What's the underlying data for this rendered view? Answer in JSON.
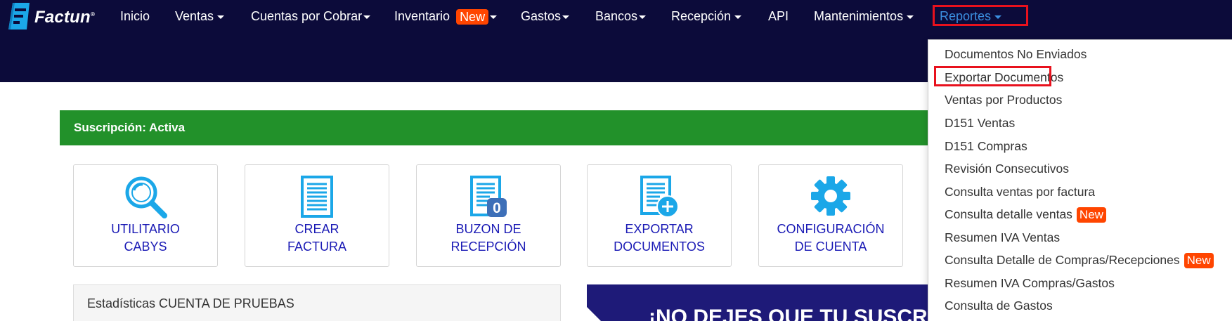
{
  "brand": {
    "name": "Factun",
    "reg": "®"
  },
  "nav": {
    "inicio": "Inicio",
    "ventas": "Ventas",
    "cuentas": "Cuentas por Cobrar",
    "inventario": "Inventario",
    "inventario_badge": "New",
    "gastos": "Gastos",
    "bancos": "Bancos",
    "recepcion": "Recepción",
    "api": "API",
    "mantenimientos": "Mantenimientos",
    "reportes": "Reportes"
  },
  "subscription": {
    "text": "Suscripción: Activa"
  },
  "cards": {
    "cabys": {
      "line1": "UTILITARIO",
      "line2": "CABYS"
    },
    "factura": {
      "line1": "CREAR",
      "line2": "FACTURA"
    },
    "buzon": {
      "line1": "BUZON DE",
      "line2": "RECEPCIÓN",
      "count": "0"
    },
    "exportar": {
      "line1": "EXPORTAR",
      "line2": "DOCUMENTOS"
    },
    "config": {
      "line1": "CONFIGURACIÓN",
      "line2": "DE CUENTA"
    }
  },
  "stats": {
    "title": "Estadísticas CUENTA DE PRUEBAS"
  },
  "promo": {
    "text": "¡NO DEJES QUE TU SUSCRI"
  },
  "reportes_menu": {
    "items": [
      {
        "label": "Documentos No Enviados"
      },
      {
        "label": "Exportar Documentos"
      },
      {
        "label": "Ventas por Productos"
      },
      {
        "label": "D151 Ventas"
      },
      {
        "label": "D151 Compras"
      },
      {
        "label": "Revisión Consecutivos"
      },
      {
        "label": "Consulta ventas por factura"
      },
      {
        "label": "Consulta detalle ventas",
        "badge": "New"
      },
      {
        "label": "Resumen IVA Ventas"
      },
      {
        "label": "Consulta Detalle de Compras/Recepciones",
        "badge": "New"
      },
      {
        "label": "Resumen IVA Compras/Gastos"
      },
      {
        "label": "Consulta de Gastos"
      }
    ]
  },
  "colors": {
    "navbar": "#0c0b3a",
    "accent_link": "#3b8fe0",
    "badge": "#ff4500",
    "subscription_green": "#22912a",
    "card_text": "#1a1ab5",
    "icon_blue": "#1ba7e8",
    "highlight_red": "#e8111d"
  },
  "icons": {
    "logo": "factun-logo-icon",
    "cabys": "magnifier-icon",
    "factura": "document-icon",
    "buzon": "document-badge-icon",
    "exportar": "document-plus-icon",
    "config": "gear-icon"
  }
}
